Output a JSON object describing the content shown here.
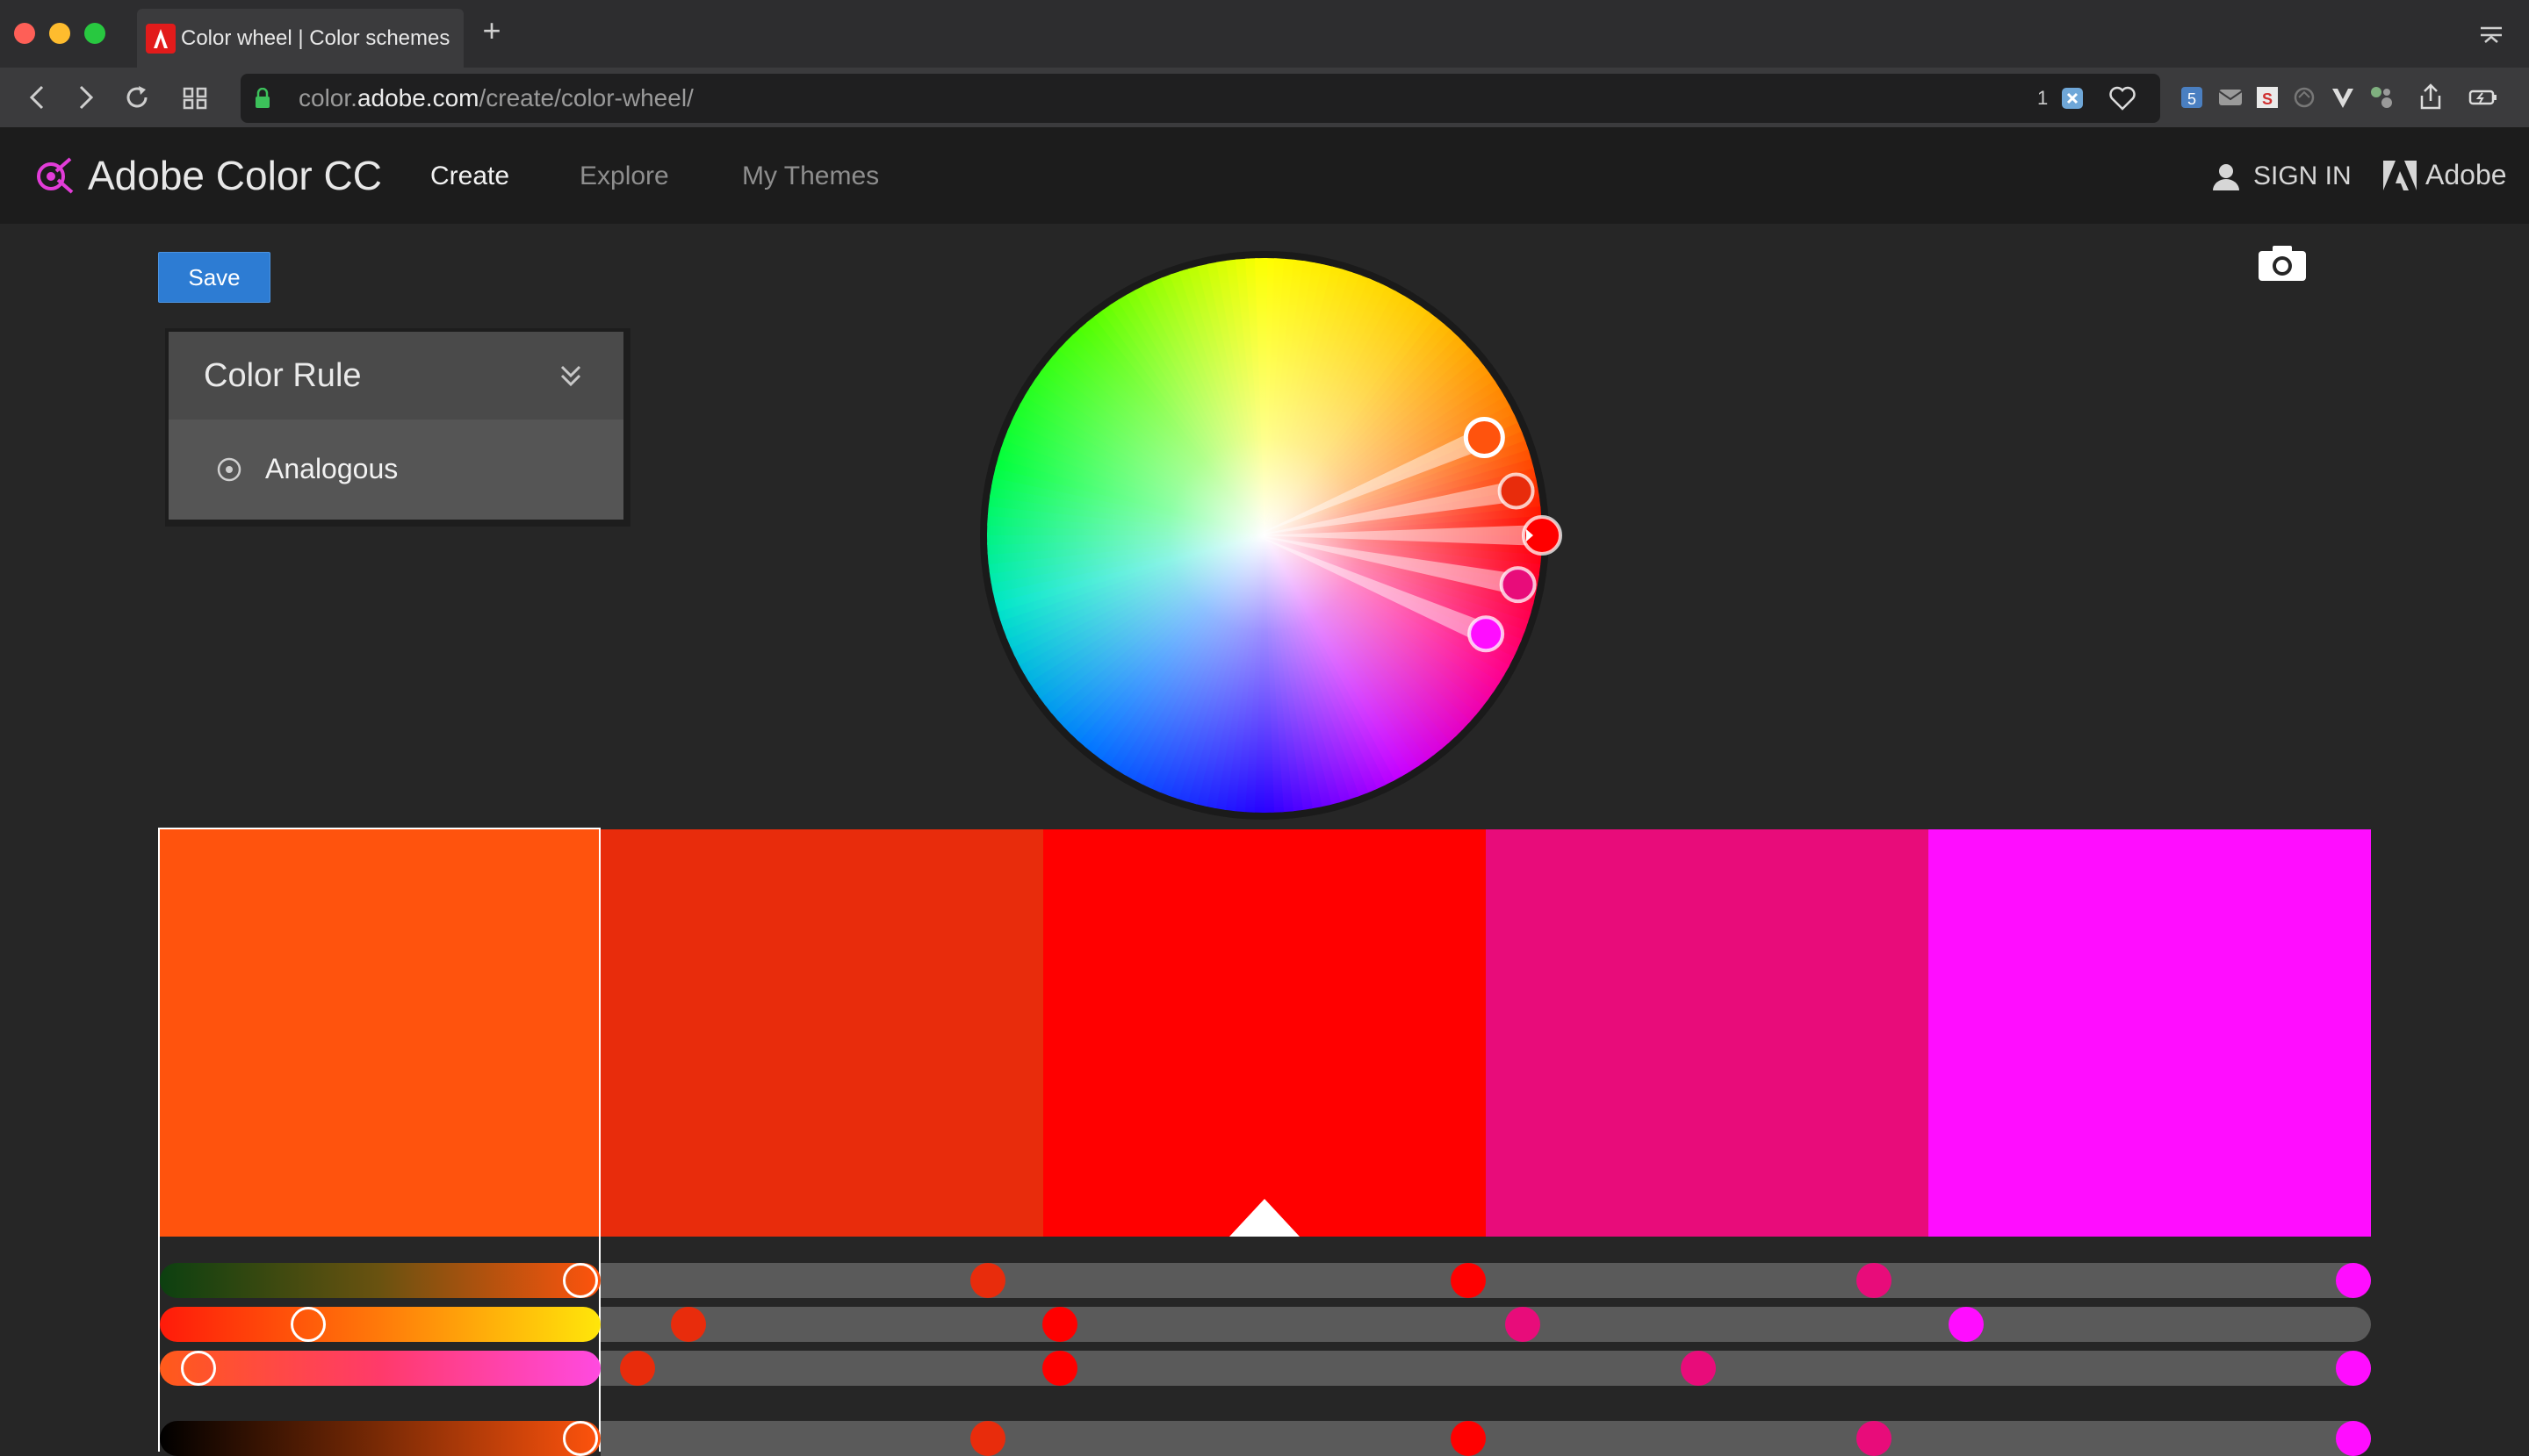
{
  "browser": {
    "tab_title": "Color wheel | Color schemes",
    "url_host_prefix": "color.",
    "url_host_domain": "adobe.com",
    "url_path": "/create/color-wheel/",
    "password_badge_count": "1",
    "new_tab_glyph": "+"
  },
  "header": {
    "brand": "Adobe Color CC",
    "nav": [
      "Create",
      "Explore",
      "My Themes"
    ],
    "active_nav": "Create",
    "sign_in": "SIGN IN",
    "adobe_label": "Adobe"
  },
  "toolbar": {
    "save_label": "Save"
  },
  "color_rule": {
    "title": "Color Rule",
    "selected": "Analogous"
  },
  "theme": {
    "swatches": [
      "#FF530D",
      "#E82C0C",
      "#FF0000",
      "#E80C7A",
      "#FF0DFF"
    ],
    "active_swatch_index": 0,
    "base_swatch_index": 2
  },
  "colors": {
    "accent": "#2D7CD3",
    "brand_icon": "#E23CD8"
  },
  "icons": {
    "lock": "lock-icon",
    "camera": "camera-icon",
    "person": "person-icon",
    "chevron": "double-chevron-down-icon",
    "radio": "radio-icon"
  }
}
